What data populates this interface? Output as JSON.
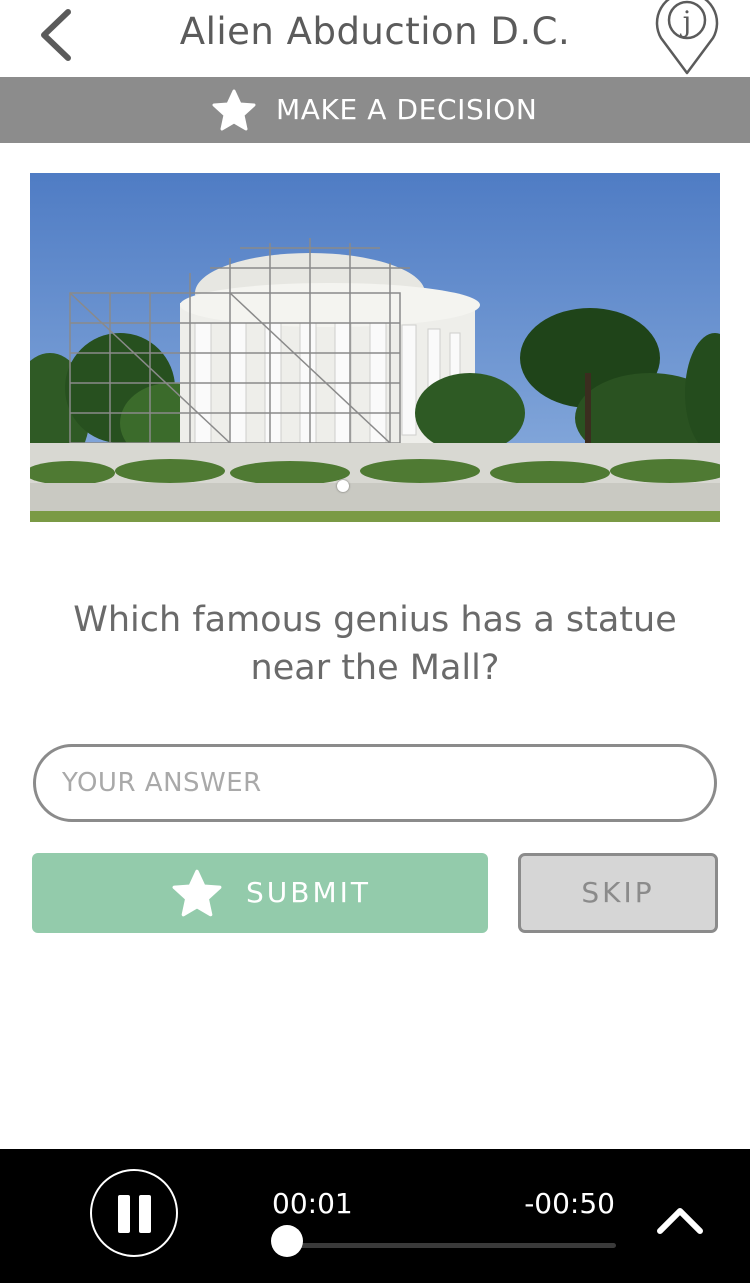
{
  "header": {
    "title": "Alien Abduction D.C.",
    "back_icon": "chevron-left-icon",
    "pin_icon": "map-pin-j-icon",
    "pin_letter": "j"
  },
  "banner": {
    "icon": "star-icon",
    "label": "MAKE A DECISION",
    "background": "#8c8c8c"
  },
  "photo": {
    "subject": "Jefferson Memorial under scaffolding",
    "slide_index": 1,
    "slide_count": 1
  },
  "question": {
    "text": "Which famous genius has a statue near the Mall?"
  },
  "answer": {
    "placeholder": "YOUR ANSWER",
    "value": ""
  },
  "actions": {
    "submit_label": "SUBMIT",
    "submit_icon": "star-icon",
    "submit_color": "#93cbab",
    "skip_label": "SKIP"
  },
  "player": {
    "elapsed": "00:01",
    "remaining": "-00:50",
    "progress": 0.02,
    "accent": "#2a5bd7",
    "pause_icon": "pause-icon",
    "expand_icon": "chevron-up-icon"
  }
}
